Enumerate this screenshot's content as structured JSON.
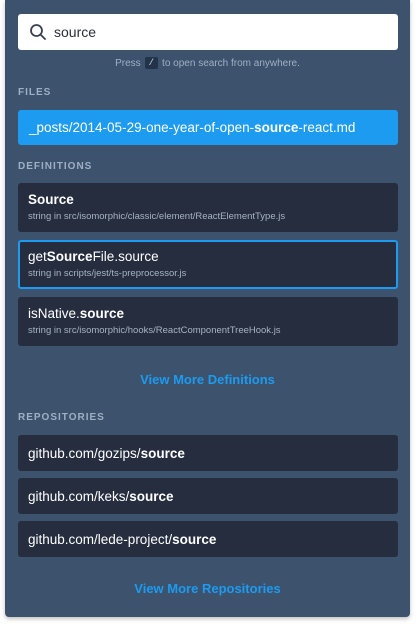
{
  "search": {
    "value": "source",
    "hint_prefix": "Press",
    "hint_key": "/",
    "hint_suffix": "to open search from anywhere."
  },
  "colors": {
    "panel": "#3d526d",
    "item": "#252d3e",
    "accent": "#1c9bf0"
  },
  "files": {
    "title": "FILES",
    "items": [
      {
        "before": "_posts/2014-05-29-one-year-of-open-",
        "match": "source",
        "after": "-react.md"
      }
    ]
  },
  "definitions": {
    "title": "DEFINITIONS",
    "items": [
      {
        "before": "",
        "match": "Source",
        "after": "",
        "sub": "string in src/isomorphic/classic/element/ReactElementType.js"
      },
      {
        "before": "get",
        "match": "Source",
        "after": "File.source",
        "sub": "string in scripts/jest/ts-preprocessor.js"
      },
      {
        "before": "isNative.",
        "match": "source",
        "after": "",
        "sub": "string in src/isomorphic/hooks/ReactComponentTreeHook.js"
      }
    ],
    "more": "View More Definitions"
  },
  "repositories": {
    "title": "REPOSITORIES",
    "items": [
      {
        "before": "github.com/gozips/",
        "match": "source"
      },
      {
        "before": "github.com/keks/",
        "match": "source"
      },
      {
        "before": "github.com/lede-project/",
        "match": "source"
      }
    ],
    "more": "View More Repositories"
  }
}
